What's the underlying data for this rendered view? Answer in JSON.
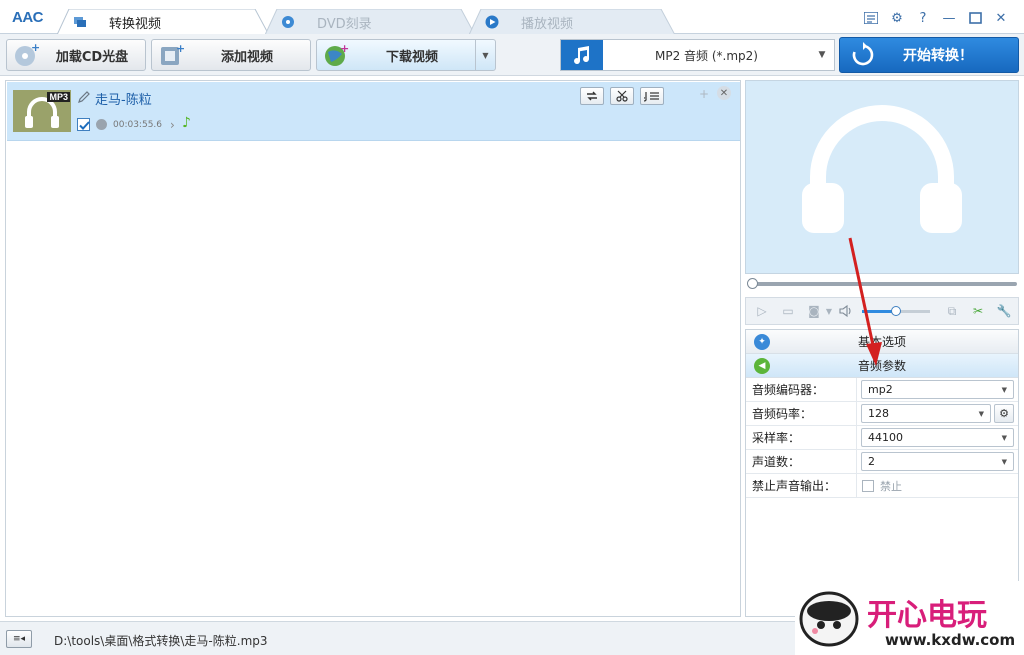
{
  "app": {
    "logo": "AAC"
  },
  "tabs": [
    {
      "label": "转换视频",
      "active": true
    },
    {
      "label": "DVD刻录",
      "active": false
    },
    {
      "label": "播放视频",
      "active": false
    }
  ],
  "window_controls": [
    "list-icon",
    "gear-icon",
    "help-icon",
    "minimize-icon",
    "maximize-icon",
    "close-icon"
  ],
  "toolbar": {
    "load_cd_label": "加载CD光盘",
    "add_video_label": "添加视频",
    "download_video_label": "下载视频",
    "format_label": "MP2 音频 (*.mp2)",
    "start_label": "开始转换！"
  },
  "files": [
    {
      "name": "走马-陈粒",
      "badge": "MP3",
      "duration": "00:03:55.6",
      "checked": true
    }
  ],
  "player": {
    "volume": 0.5,
    "position": 0
  },
  "settings": {
    "basic_section": "基本选项",
    "audio_section": "音频参数",
    "rows": [
      {
        "name": "音频编码器：",
        "value": "mp2"
      },
      {
        "name": "音频码率：",
        "value": "128"
      },
      {
        "name": "采样率：",
        "value": "44100"
      },
      {
        "name": "声道数：",
        "value": "2"
      },
      {
        "name": "禁止声音输出：",
        "value": "禁止"
      }
    ]
  },
  "statusbar": {
    "path": "D:\\tools\\桌面\\格式转换\\走马-陈粒.mp3"
  },
  "watermark": {
    "text": "开心电玩",
    "url": "www.kxdw.com"
  },
  "colors": {
    "accent": "#1e73c7",
    "selection": "#cce6fa",
    "preview_bg": "#d7ebf9",
    "arrow": "#d32020"
  }
}
